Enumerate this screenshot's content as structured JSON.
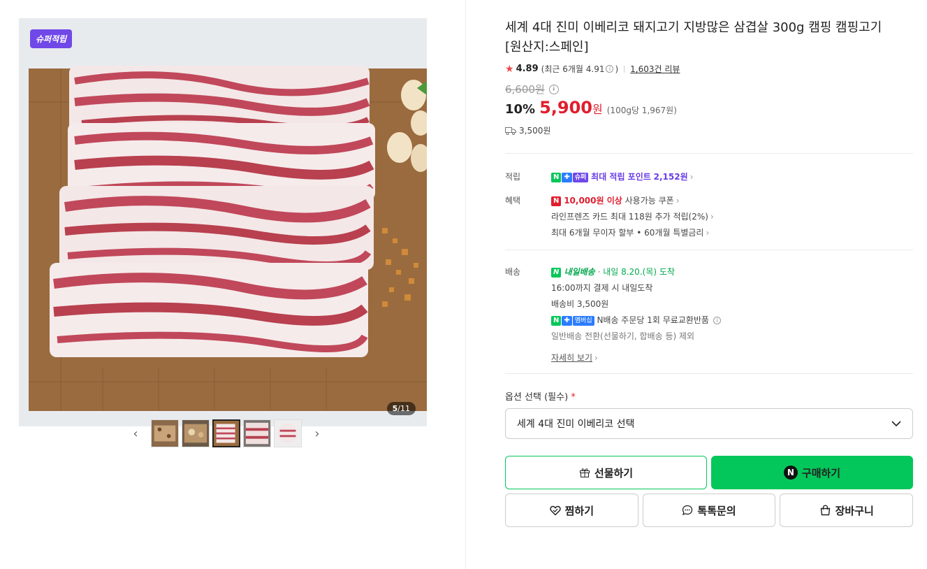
{
  "gallery": {
    "badge": "슈퍼적립",
    "page_current": "5",
    "page_total": "/11",
    "prev_icon": "chevron-left-icon",
    "next_icon": "chevron-right-icon"
  },
  "product": {
    "title": "세계 4대 진미 이베리코 돼지고기 지방많은 삼겹살 300g 캠핑 캠핑고기 [원산지:스페인]",
    "rating": "4.89",
    "rating_recent": "(최근 6개월 4.91",
    "rating_recent_close": ")",
    "reviews": "1,603건 리뷰",
    "original_price": "6,600원",
    "discount": "10%",
    "price": "5,900",
    "won": "원",
    "unit_price": "(100g당 1,967원)",
    "shipping_fee": "3,500원"
  },
  "points": {
    "label": "적립",
    "tag_n": "N",
    "tag_plus": "✚",
    "tag_super": "슈퍼",
    "text": "최대 적립 포인트",
    "amount": "2,152원"
  },
  "benefits": {
    "label": "혜택",
    "coupon_tag": "N",
    "coupon_strong": "10,000원 이상",
    "coupon_text": "사용가능 쿠폰",
    "card": "라인프렌즈 카드 최대 118원 추가 적립(2%)",
    "installment": "최대 6개월 무이자 할부 • 60개월 특별금리"
  },
  "delivery": {
    "label": "배송",
    "badge": "내일배송",
    "arrival": "내일 8.20.(목) 도착",
    "cutoff": "16:00까지 결제 시 내일도착",
    "fee": "배송비 3,500원",
    "member_tag": "멤버십",
    "exchange": "N배송 주문당 1회 무료교환반품",
    "exclusion": "일반배송 전환(선물하기, 합배송 등) 제외",
    "details": "자세히 보기"
  },
  "option": {
    "label": "옵션 선택 (필수)",
    "required_mark": "*",
    "selected": "세계 4대 진미 이베리코 선택"
  },
  "buttons": {
    "gift": "선물하기",
    "buy": "구매하기",
    "wish": "찜하기",
    "talk": "톡톡문의",
    "cart": "장바구니"
  },
  "colors": {
    "accent_green": "#03c75a",
    "price_red": "#e01e2e",
    "super_purple": "#7048e8"
  }
}
